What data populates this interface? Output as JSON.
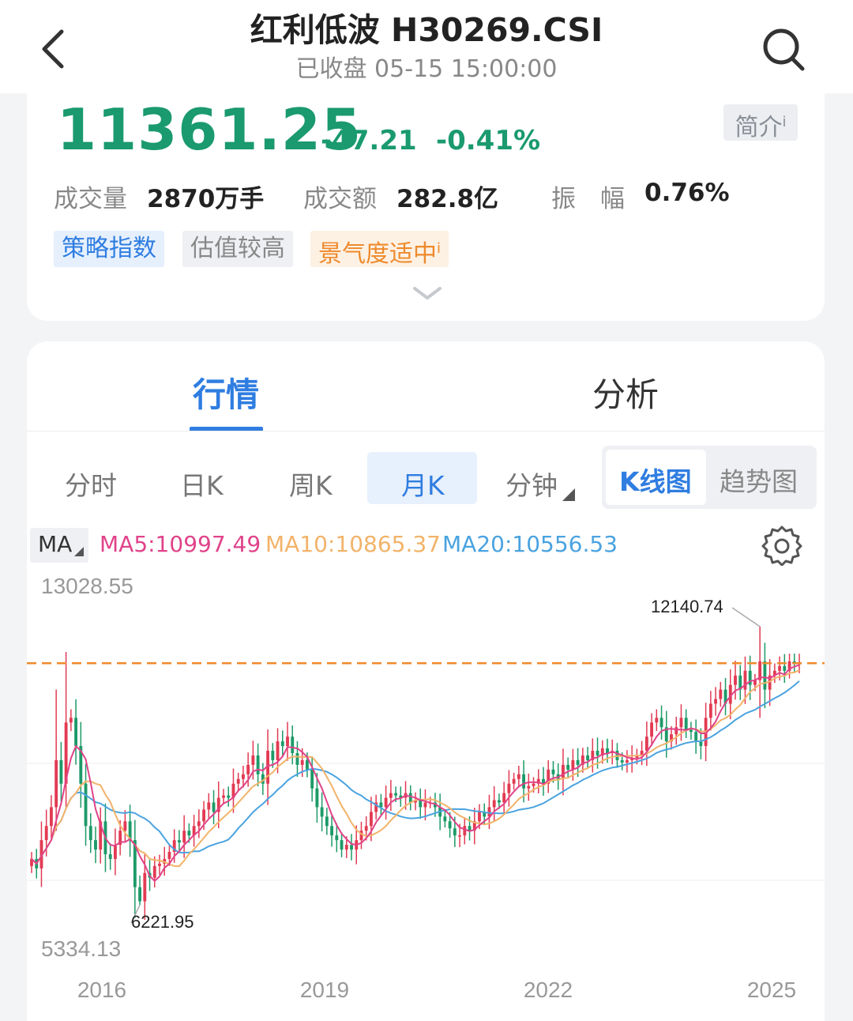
{
  "header": {
    "title": "红利低波 H30269.CSI",
    "subtitle": "已收盘 05-15 15:00:00"
  },
  "quote": {
    "price": "11361.25",
    "change": "-47.21",
    "change_pct": "-0.41%",
    "intro_label": "简介",
    "stats": [
      {
        "label": "成交量",
        "value": "2870万手"
      },
      {
        "label": "成交额",
        "value": "282.8亿"
      },
      {
        "label": "振　幅",
        "value": "0.76%"
      }
    ],
    "tags": [
      "策略指数",
      "估值较高",
      "景气度适中"
    ],
    "colors": {
      "down": "#1a9a6e",
      "accent": "#2f7de1"
    }
  },
  "tabs": [
    "行情",
    "分析"
  ],
  "periods": [
    "分时",
    "日K",
    "周K",
    "月K",
    "分钟"
  ],
  "selected_period": "月K",
  "chart_modes": [
    "K线图",
    "趋势图"
  ],
  "ma": {
    "label": "MA",
    "ma5": "MA5:10997.49",
    "ma10": "MA10:10865.37",
    "ma20": "MA20:10556.53",
    "colors": {
      "ma5": "#e0438a",
      "ma10": "#f2b36a",
      "ma20": "#4aa3e0"
    }
  },
  "chart_data": {
    "type": "candlestick",
    "y_max_label": "13028.55",
    "y_min_label": "5334.13",
    "ylim": [
      5334.13,
      13028.55
    ],
    "x_ticks": [
      "2016",
      "2019",
      "2022",
      "2025"
    ],
    "high_annotation": "12140.74",
    "low_annotation": "6221.95",
    "high_value": 12140.74,
    "low_value": 6221.95,
    "last_close": 11361.25,
    "colors": {
      "up": "#e23b53",
      "down": "#1d9a68",
      "ref_line": "#f08a2c"
    },
    "closes": [
      7200,
      7000,
      7600,
      7900,
      8300,
      9300,
      8800,
      10100,
      10200,
      9600,
      8800,
      7900,
      7600,
      7400,
      8000,
      7300,
      7200,
      7500,
      7800,
      8000,
      7600,
      6600,
      6300,
      6900,
      6800,
      7050,
      7100,
      7200,
      7350,
      7600,
      7550,
      7800,
      7700,
      7900,
      8000,
      8250,
      8400,
      8200,
      8500,
      8550,
      8500,
      8800,
      8900,
      9000,
      9200,
      9400,
      9000,
      8800,
      9500,
      9300,
      9700,
      9600,
      9800,
      9450,
      9200,
      9300,
      9100,
      8700,
      8300,
      8100,
      7900,
      7700,
      7600,
      7400,
      7500,
      7400,
      7600,
      7800,
      7900,
      8200,
      8400,
      8300,
      8500,
      8600,
      8550,
      8500,
      8600,
      8400,
      8450,
      8300,
      8400,
      8400,
      8300,
      8100,
      8000,
      7850,
      7700,
      7700,
      7900,
      7800,
      8000,
      8200,
      8100,
      8300,
      8450,
      8400,
      8600,
      8800,
      8900,
      9000,
      8700,
      8750,
      8800,
      8900,
      8800,
      9100,
      9000,
      8900,
      9200,
      9100,
      9300,
      9200,
      9400,
      9300,
      9500,
      9400,
      9550,
      9450,
      9500,
      9300,
      9250,
      9300,
      9350,
      9400,
      9500,
      9800,
      10100,
      10200,
      10000,
      9700,
      9850,
      10000,
      10200,
      9950,
      9900,
      9700,
      9600,
      10200,
      10500,
      10600,
      10800,
      10500,
      10900,
      11100,
      10800,
      11200,
      10900,
      11000,
      11400,
      10800,
      11100,
      11200,
      11300,
      11200,
      11400,
      11350,
      11361.25
    ]
  }
}
